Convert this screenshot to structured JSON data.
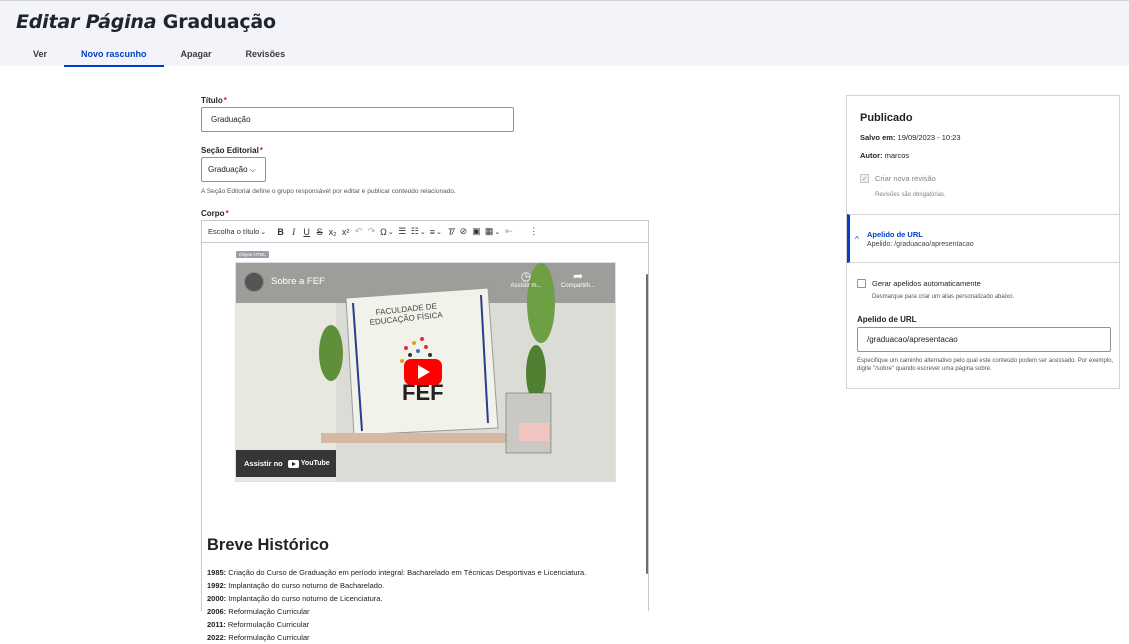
{
  "header": {
    "title_prefix": "Editar Página",
    "title_suffix": "Graduação",
    "tabs": [
      {
        "label": "Ver"
      },
      {
        "label": "Novo rascunho"
      },
      {
        "label": "Apagar"
      },
      {
        "label": "Revisões"
      }
    ]
  },
  "form": {
    "titulo_label": "Título",
    "titulo_value": "Graduação",
    "secao_label": "Seção Editorial",
    "secao_value": "Graduação",
    "secao_desc": "A Seção Editorial define o grupo responsável por editar e publicar conteúdo relacionado.",
    "corpo_label": "Corpo",
    "required_mark": "*"
  },
  "toolbar": {
    "heading": "Escolha o título",
    "buttons": [
      "bold-icon",
      "italic-icon",
      "underline-icon",
      "strikethrough-icon",
      "subscript-icon",
      "superscript-icon",
      "undo-icon",
      "redo-icon",
      "special-characters-icon",
      "bulleted-list-icon",
      "numbered-list-icon",
      "align-icon",
      "remove-format-icon",
      "link-icon",
      "image-icon",
      "table-icon",
      "outdent-icon",
      "more-icon"
    ]
  },
  "editor": {
    "html_tag": "Objeto HTML",
    "video_title": "Sobre a FEF",
    "watch_later": "Assistir m...",
    "share": "Compartilh...",
    "watch_on": "Assistir no",
    "youtube": "YouTube",
    "section_title": "Breve Histórico",
    "history": [
      {
        "year": "1985:",
        "text": "Criação do Curso de Graduação em período integral: Bacharelado em Técnicas Desportivas e Licenciatura."
      },
      {
        "year": "1992:",
        "text": "Implantação do curso noturno de Bacharelado."
      },
      {
        "year": "2000:",
        "text": "Implantação do curso noturno de Licenciatura."
      },
      {
        "year": "2006:",
        "text": "Reformulação Curricular"
      },
      {
        "year": "2011:",
        "text": "Reformulação Curricular"
      },
      {
        "year": "2022:",
        "text": "Reformulação Curricular"
      }
    ]
  },
  "sidebar": {
    "status": "Publicado",
    "saved_label": "Salvo em:",
    "saved_value": "19/09/2023 - 10:23",
    "author_label": "Autor:",
    "author_value": "marcos",
    "revision_label": "Criar nova revisão",
    "revision_desc": "Revisões são obrigatórias.",
    "url_alias_title": "Apelido de URL",
    "url_alias_summary": "Apelido: /graduacao/apresentacao",
    "generate_label": "Gerar apelidos automaticamente",
    "generate_desc": "Desmarque para criar um alias personalizado abaixo.",
    "alias_label": "Apelido de URL",
    "alias_value": "/graduacao/apresentacao",
    "alias_desc": "Especifique um caminho alternativo pelo qual este conteúdo podem ser acessado. Por exemplo, digite \"/sobre\" quando escrever uma página sobre."
  },
  "colors": {
    "accent": "#003ecc",
    "required": "#dc2323",
    "header_bg": "#f3f4f9"
  }
}
